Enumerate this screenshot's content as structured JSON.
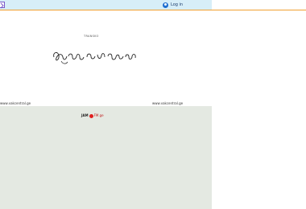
{
  "header": {
    "login_label": "Log in",
    "accent_color": "#f0a030",
    "bar_color": "#d7eef8",
    "user_icon": "user-circle-icon",
    "corner_icon": "chevron-right-icon"
  },
  "site": {
    "caption": "TRANSKO",
    "logo_script": "Georgian handwritten script logo"
  },
  "footer": {
    "url_left": "www.vakcentral.ge",
    "url_right": "www.vakcentral.ge"
  },
  "badge": {
    "brand": "JAM",
    "suffix": "FM.ge",
    "color": "#e02020"
  },
  "map": {
    "background": "#e4e9e2"
  }
}
